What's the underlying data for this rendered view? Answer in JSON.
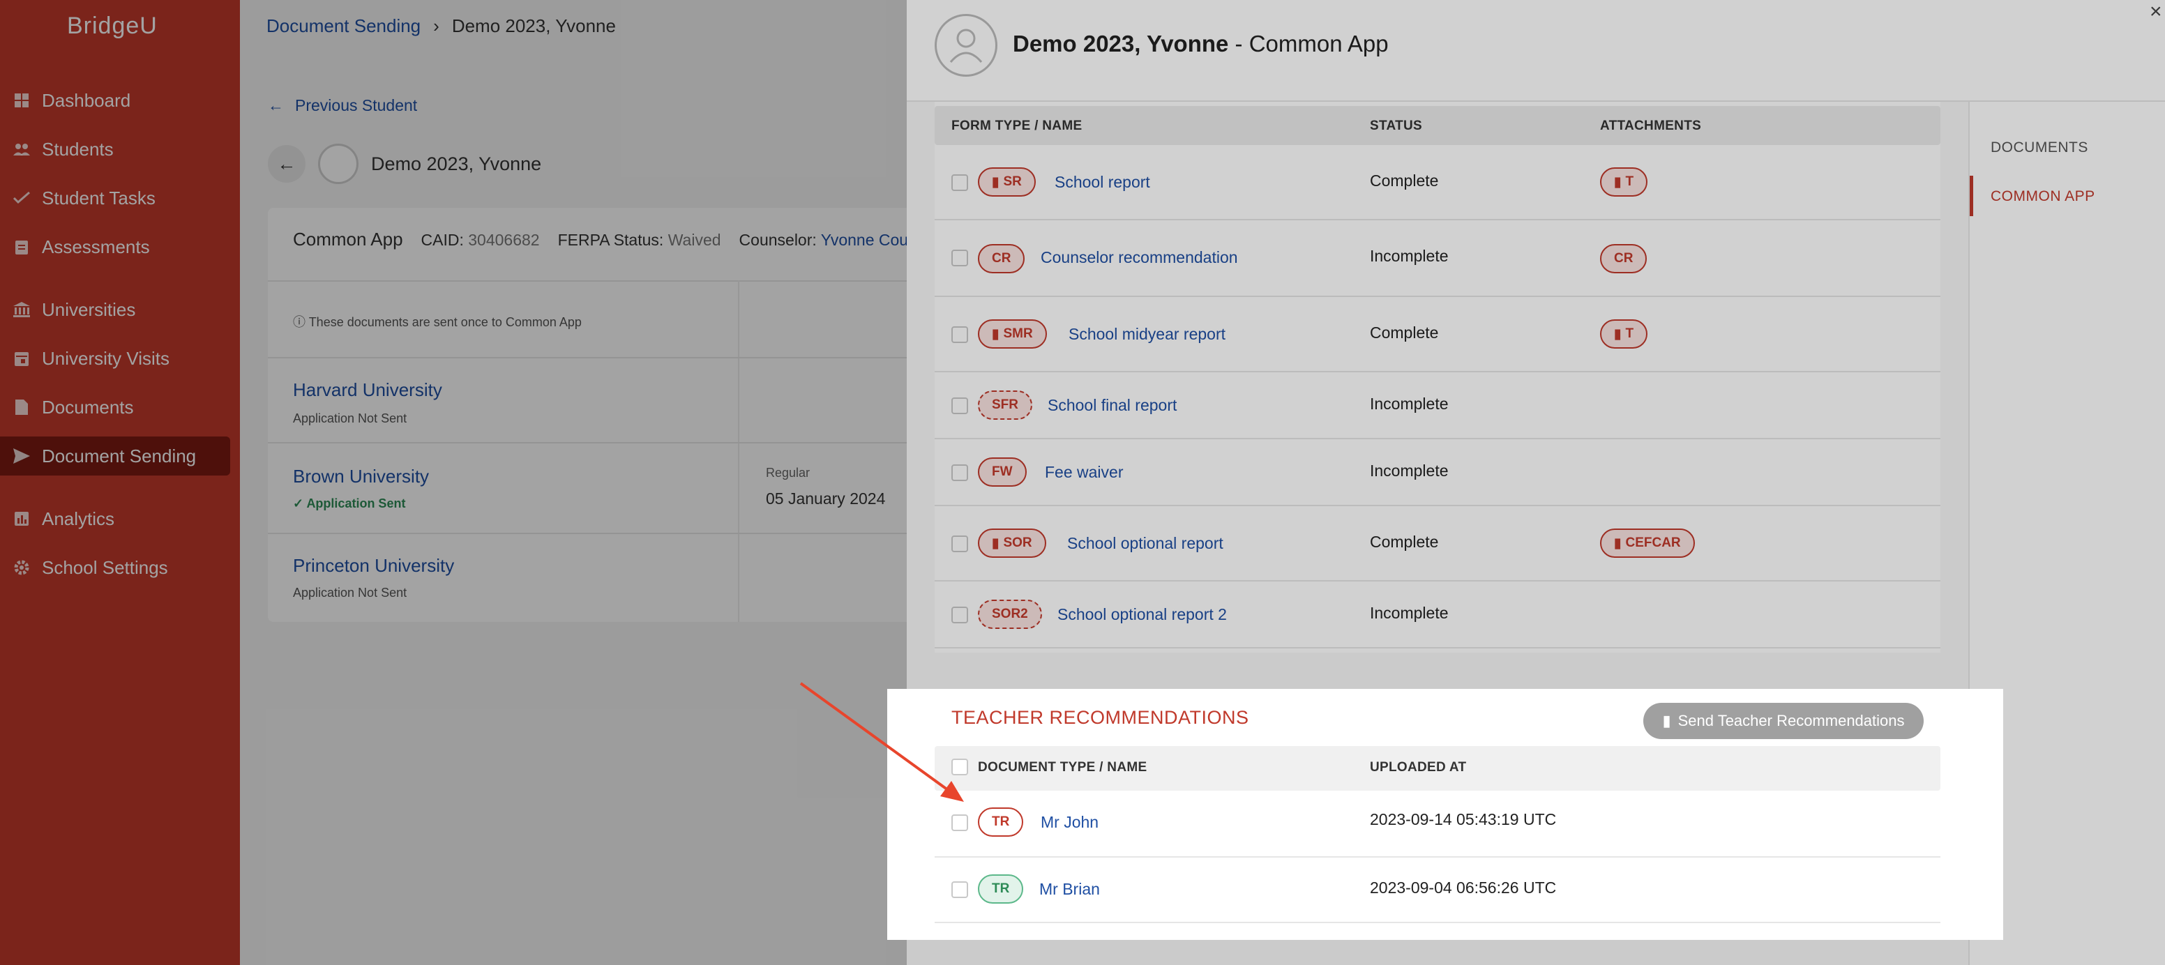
{
  "sidebar": {
    "logo": "BridgeU",
    "items": [
      {
        "label": "Dashboard",
        "icon": "dashboard-icon"
      },
      {
        "label": "Students",
        "icon": "students-icon"
      },
      {
        "label": "Student Tasks",
        "icon": "tasks-icon"
      },
      {
        "label": "Assessments",
        "icon": "clipboard-icon"
      },
      {
        "label": "Universities",
        "icon": "university-icon"
      },
      {
        "label": "University Visits",
        "icon": "calendar-icon"
      },
      {
        "label": "Documents",
        "icon": "document-icon"
      },
      {
        "label": "Document Sending",
        "icon": "send-icon",
        "active": true
      },
      {
        "label": "Analytics",
        "icon": "analytics-icon"
      },
      {
        "label": "School Settings",
        "icon": "gear-icon"
      }
    ]
  },
  "breadcrumb": {
    "parent": "Document Sending",
    "current": "Demo 2023, Yvonne"
  },
  "previous_student": "Previous Student",
  "student_name": "Demo 2023, Yvonne",
  "card": {
    "title": "Common App",
    "caid_label": "CAID:",
    "caid": "30406682",
    "ferpa_label": "FERPA Status:",
    "ferpa": "Waived",
    "counselor_label": "Counselor:",
    "counselor": "Yvonne Couns",
    "note": "These documents are sent once to Common App",
    "universities": [
      {
        "name": "Harvard University",
        "status": "Application Not Sent"
      },
      {
        "name": "Brown University",
        "status": "Application Sent",
        "round": "Regular",
        "date": "05 January 2024"
      },
      {
        "name": "Princeton University",
        "status": "Application Not Sent"
      }
    ]
  },
  "drawer": {
    "title_name": "Demo 2023, Yvonne",
    "title_sep": " - ",
    "title_app": "Common App",
    "close": "×",
    "side_tabs": [
      "DOCUMENTS",
      "COMMON APP"
    ],
    "columns": {
      "name": "FORM TYPE / NAME",
      "status": "STATUS",
      "attachments": "ATTACHMENTS"
    },
    "forms": [
      {
        "code": "SR",
        "name": "School report",
        "status": "Complete",
        "attachment": "T"
      },
      {
        "code": "CR",
        "name": "Counselor recommendation",
        "status": "Incomplete",
        "attachment": "CR"
      },
      {
        "code": "SMR",
        "name": "School midyear report",
        "status": "Complete",
        "attachment": "T"
      },
      {
        "code": "SFR",
        "name": "School final report",
        "status": "Incomplete",
        "attachment": ""
      },
      {
        "code": "FW",
        "name": "Fee waiver",
        "status": "Incomplete",
        "attachment": ""
      },
      {
        "code": "SOR",
        "name": "School optional report",
        "status": "Complete",
        "attachment": "CEFCAR"
      },
      {
        "code": "SOR2",
        "name": "School optional report 2",
        "status": "Incomplete",
        "attachment": ""
      }
    ],
    "teacher": {
      "title": "TEACHER RECOMMENDATIONS",
      "send_button": "Send Teacher Recommendations",
      "columns": {
        "name": "DOCUMENT TYPE / NAME",
        "uploaded": "UPLOADED AT"
      },
      "rows": [
        {
          "code": "TR",
          "name": "Mr John",
          "uploaded": "2023-09-14 05:43:19 UTC"
        },
        {
          "code": "TR",
          "name": "Mr Brian",
          "uploaded": "2023-09-04 06:56:26 UTC"
        }
      ]
    }
  },
  "colors": {
    "brand": "#c0392b",
    "link": "#1f4fa3",
    "arrow": "#e8452c"
  }
}
